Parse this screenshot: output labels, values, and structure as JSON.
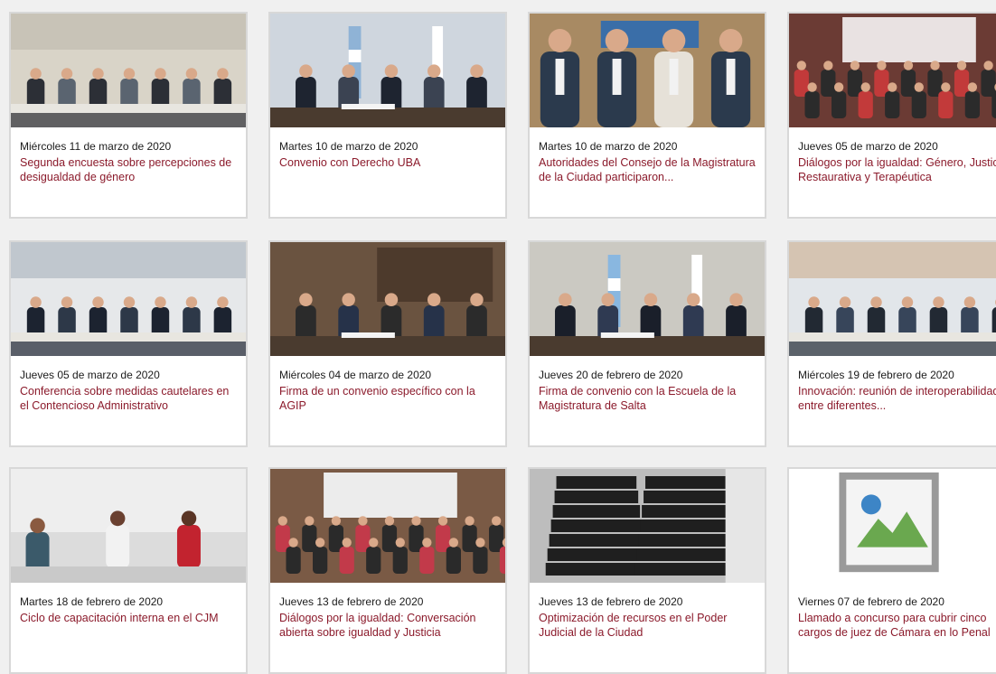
{
  "news": [
    {
      "date": "Miércoles 11 de marzo de 2020",
      "title": "Segunda encuesta sobre percepciones de desigualdad de género",
      "scene": "meeting-room",
      "palette": [
        "#d9d4c8",
        "#5a6470",
        "#2c2f36",
        "#b7b2a6"
      ]
    },
    {
      "date": "Martes 10 de marzo de 2020",
      "title": "Convenio con Derecho UBA",
      "scene": "signing-flags",
      "palette": [
        "#cfd6de",
        "#3b4352",
        "#1e2430",
        "#8fb3d6"
      ]
    },
    {
      "date": "Martes 10 de marzo de 2020",
      "title": "Autoridades del Consejo de la Magistratura de la Ciudad participaron...",
      "scene": "group-stand",
      "palette": [
        "#a88a63",
        "#2b3a4d",
        "#e6e1d8",
        "#3a6ea8"
      ]
    },
    {
      "date": "Jueves 05 de marzo de 2020",
      "title": "Diálogos por la igualdad: Género, Justicia Restaurativa y Terapéutica",
      "scene": "crowd-banner",
      "palette": [
        "#6b3b34",
        "#c23a3a",
        "#e9e2e2",
        "#2b2b2b"
      ]
    },
    {
      "date": "Jueves 05 de marzo de 2020",
      "title": "Conferencia sobre medidas cautelares en el Contencioso Administrativo",
      "scene": "meeting-room",
      "palette": [
        "#e6e8ea",
        "#2d3848",
        "#1c2330",
        "#9aa6b2"
      ]
    },
    {
      "date": "Miércoles 04 de marzo de 2020",
      "title": "Firma de un convenio específico con la AGIP",
      "scene": "signing",
      "palette": [
        "#6a5340",
        "#263249",
        "#2b2b2b",
        "#c9c2b3"
      ]
    },
    {
      "date": "Jueves 20 de febrero de 2020",
      "title": "Firma de convenio con la Escuela de la Magistratura de Salta",
      "scene": "signing-flags",
      "palette": [
        "#cbc9c2",
        "#2f3a52",
        "#1a1f2a",
        "#89b7e0"
      ]
    },
    {
      "date": "Miércoles 19 de febrero de 2020",
      "title": "Innovación: reunión de interoperabilidad entre diferentes...",
      "scene": "meeting-room",
      "palette": [
        "#e2e6ea",
        "#37455a",
        "#222933",
        "#c8a27a"
      ]
    },
    {
      "date": "Martes 18 de febrero de 2020",
      "title": "Ciclo de capacitación interna en el CJM",
      "scene": "women-table",
      "palette": [
        "#dcdcdc",
        "#2b2b2b",
        "#c2232f",
        "#9aa0a6"
      ]
    },
    {
      "date": "Jueves 13 de febrero de 2020",
      "title": "Diálogos por la igualdad: Conversación abierta sobre igualdad y Justicia",
      "scene": "crowd-banner",
      "palette": [
        "#7a5a45",
        "#c23a4a",
        "#ececec",
        "#2a2a2a"
      ]
    },
    {
      "date": "Jueves 13 de febrero de 2020",
      "title": "Optimización de recursos en el Poder Judicial de la Ciudad",
      "scene": "chairs",
      "palette": [
        "#bdbdbd",
        "#1f1f1f",
        "#8a8a8a",
        "#e6e6e6"
      ]
    },
    {
      "date": "Viernes 07 de febrero de 2020",
      "title": "Llamado a concurso para cubrir cinco cargos de juez de Cámara en lo Penal",
      "scene": "broken",
      "palette": [
        "#ffffff",
        "#ffffff",
        "#ffffff",
        "#ffffff"
      ]
    }
  ]
}
